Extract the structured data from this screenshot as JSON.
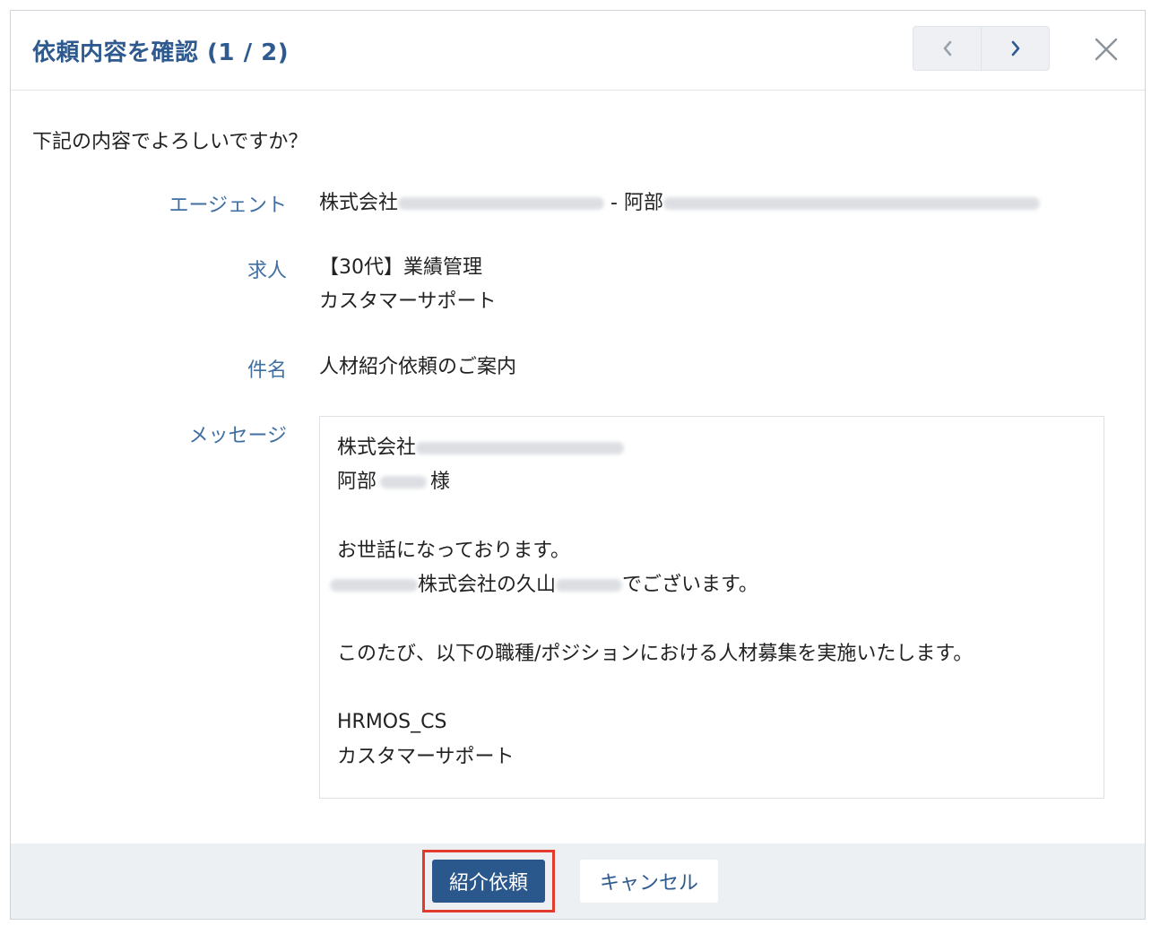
{
  "dialog": {
    "title": "依頼内容を確認 (1 / 2)",
    "question": "下記の内容でよろしいですか？"
  },
  "nav": {
    "prev_icon": "chevron-left-icon",
    "next_icon": "chevron-right-icon",
    "close_icon": "close-icon"
  },
  "fields": {
    "agent_label": "エージェント",
    "agent_company_prefix": "株式会社",
    "agent_separator": " - 阿部",
    "job_label": "求人",
    "job_line1": "【30代】業績管理",
    "job_line2": "カスタマーサポート",
    "subject_label": "件名",
    "subject_value": "人材紹介依頼のご案内",
    "message_label": "メッセージ"
  },
  "message": {
    "line1": "株式会社",
    "line2_prefix": "阿部",
    "line2_suffix": "様",
    "line4": "お世話になっております。",
    "line5_mid": "株式会社の久山",
    "line5_suffix": "でございます。",
    "line7": "このたび、以下の職種/ポジションにおける人材募集を実施いたします。",
    "line9": "HRMOS_CS",
    "line10": "カスタマーサポート"
  },
  "footer": {
    "submit_label": "紹介依頼",
    "cancel_label": "キャンセル"
  },
  "colors": {
    "accent": "#2a578c",
    "highlight_border": "#e23b2e"
  }
}
